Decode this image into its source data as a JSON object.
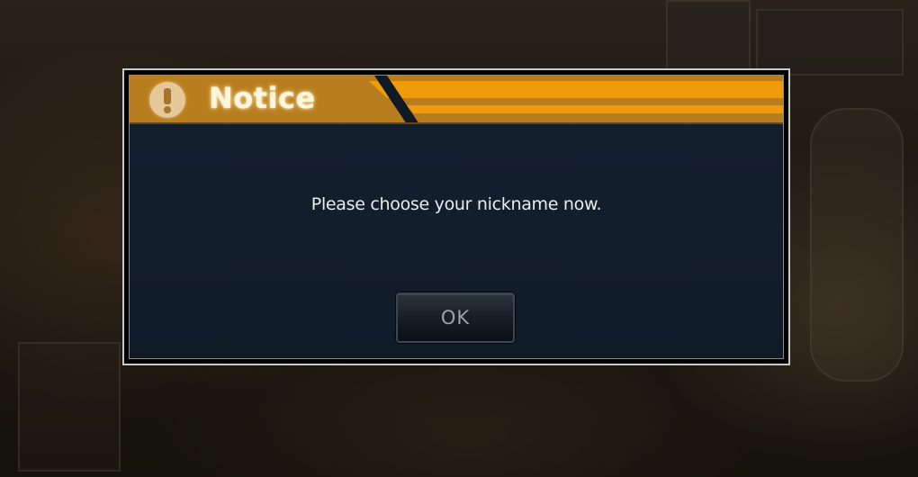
{
  "dialog": {
    "title": "Notice",
    "icon": "exclamation-icon",
    "message": "Please choose your nickname now.",
    "ok_label": "OK"
  },
  "colors": {
    "title_bar": "#b87d1e",
    "title_stripe": "#f09a0c",
    "dialog_body": "#121d2b",
    "border": "#c9c9c9"
  }
}
